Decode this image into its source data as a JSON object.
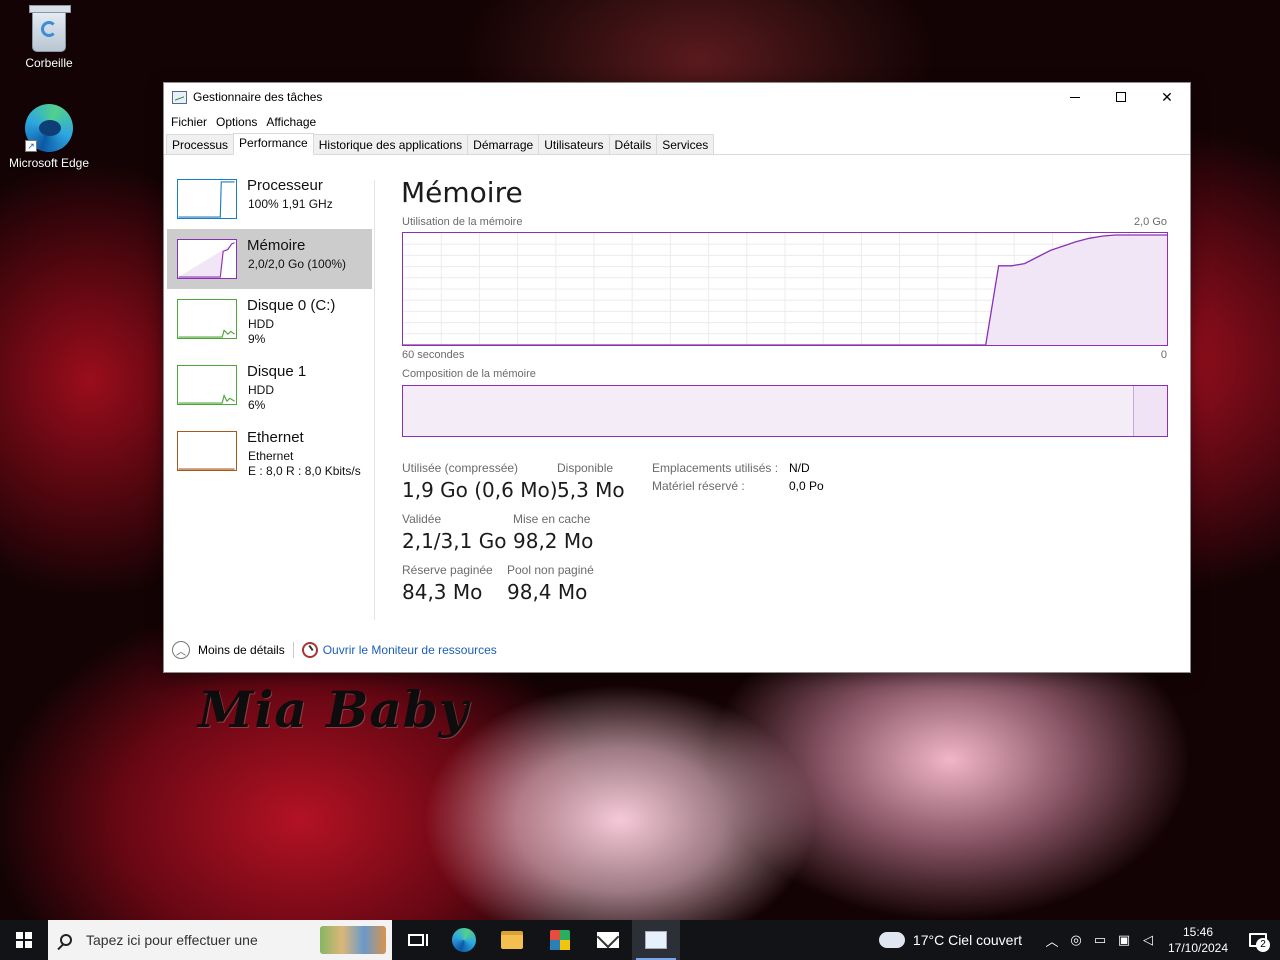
{
  "desktop": {
    "icons": [
      {
        "label": "Corbeille",
        "icon": "recycle-bin-icon"
      },
      {
        "label": "Microsoft Edge",
        "icon": "edge-icon"
      }
    ],
    "wallpaper_signature": "Mia Baby"
  },
  "window": {
    "title": "Gestionnaire des tâches",
    "menu": [
      "Fichier",
      "Options",
      "Affichage"
    ],
    "tabs": [
      "Processus",
      "Performance",
      "Historique des applications",
      "Démarrage",
      "Utilisateurs",
      "Détails",
      "Services"
    ],
    "active_tab": "Performance"
  },
  "sidebar": [
    {
      "name": "Processeur",
      "line1": "100%  1,91 GHz",
      "line2": "",
      "color": "#1b7ec2",
      "selected": false
    },
    {
      "name": "Mémoire",
      "line1": "2,0/2,0 Go (100%)",
      "line2": "",
      "color": "#8b2fb5",
      "selected": true
    },
    {
      "name": "Disque 0 (C:)",
      "line1": "HDD",
      "line2": "9%",
      "color": "#4da637",
      "selected": false
    },
    {
      "name": "Disque 1",
      "line1": "HDD",
      "line2": "6%",
      "color": "#4da637",
      "selected": false
    },
    {
      "name": "Ethernet",
      "line1": "Ethernet",
      "line2": "E : 8,0  R : 8,0 Kbits/s",
      "color": "#a7581c",
      "selected": false
    }
  ],
  "memory": {
    "title": "Mémoire",
    "usage_label": "Utilisation de la mémoire",
    "usage_max": "2,0 Go",
    "time_left": "60 secondes",
    "time_right": "0",
    "composition_label": "Composition de la mémoire",
    "usage_series": [
      0,
      0,
      0,
      0,
      0,
      0,
      0,
      0,
      0,
      0,
      0,
      0,
      0,
      0,
      0,
      0,
      0,
      0,
      0,
      0,
      0,
      0,
      0,
      0,
      0,
      0,
      0,
      0,
      0,
      0,
      0,
      0,
      0,
      0,
      0,
      0,
      0,
      0,
      0,
      0,
      0,
      0,
      0,
      0,
      0,
      0,
      0.72,
      0.72,
      0.74,
      0.8,
      0.86,
      0.9,
      0.94,
      0.97,
      0.99,
      1.0,
      1.0,
      1.0,
      1.0,
      1.0
    ],
    "stats": [
      {
        "label": "Utilisée (compressée)",
        "value": "1,9 Go (0,6 Mo)"
      },
      {
        "label": "Disponible",
        "value": "5,3 Mo"
      },
      {
        "label": "Validée",
        "value": "2,1/3,1 Go"
      },
      {
        "label": "Mise en cache",
        "value": "98,2 Mo"
      },
      {
        "label": "Réserve paginée",
        "value": "84,3 Mo"
      },
      {
        "label": "Pool non paginé",
        "value": "98,4 Mo"
      }
    ],
    "slots_label": "Emplacements utilisés :",
    "slots_value": "N/D",
    "reserved_label": "Matériel réservé :",
    "reserved_value": "0,0 Po"
  },
  "footer": {
    "fewer_details": "Moins de détails",
    "resource_monitor": "Ouvrir le Moniteur de ressources"
  },
  "taskbar": {
    "search_placeholder": "Tapez ici pour effectuer une",
    "weather": "17°C  Ciel couvert",
    "time": "15:46",
    "date": "17/10/2024",
    "notifications": "2"
  }
}
